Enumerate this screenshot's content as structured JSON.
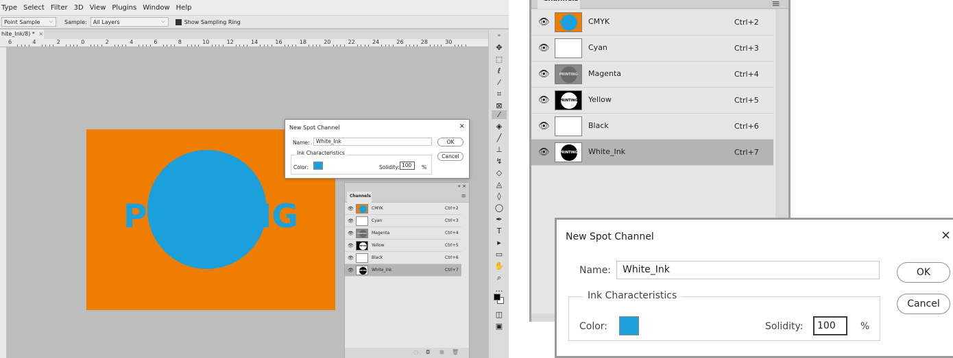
{
  "menu": [
    "Type",
    "Select",
    "Filter",
    "3D",
    "View",
    "Plugins",
    "Window",
    "Help"
  ],
  "options": {
    "sample_size": "Point Sample",
    "sample_label": "Sample:",
    "sample_value": "All Layers",
    "ring_label": "Show Sampling Ring"
  },
  "document": {
    "tab_label": "hite_Ink/8) *",
    "close": "×"
  },
  "ruler_labels": [
    "6",
    "4",
    "2",
    "0",
    "2",
    "4",
    "6",
    "8",
    "10",
    "12",
    "14",
    "16",
    "18",
    "20",
    "22",
    "24",
    "26",
    "28",
    "30"
  ],
  "artwork": {
    "text": "PRINTING"
  },
  "channels": {
    "tab": "Channels",
    "rows": [
      {
        "name": "CMYK",
        "shortcut": "Ctrl+2"
      },
      {
        "name": "Cyan",
        "shortcut": "Ctrl+3"
      },
      {
        "name": "Magenta",
        "shortcut": "Ctrl+4"
      },
      {
        "name": "Yellow",
        "shortcut": "Ctrl+5"
      },
      {
        "name": "Black",
        "shortcut": "Ctrl+6"
      },
      {
        "name": "White_Ink",
        "shortcut": "Ctrl+7",
        "selected": true
      }
    ],
    "thumb_word": "PRINTING"
  },
  "dialog": {
    "title": "New Spot Channel",
    "name_label": "Name:",
    "name_value": "White_Ink",
    "ok_label": "OK",
    "cancel_label": "Cancel",
    "group_label": "Ink Characteristics",
    "color_label": "Color:",
    "solidity_label": "Solidity:",
    "solidity_value": "100",
    "percent": "%",
    "close": "×",
    "swatch_color": "#1ba0dc"
  },
  "colors": {
    "orange": "#ef7d00",
    "blue": "#1ba0dc"
  }
}
